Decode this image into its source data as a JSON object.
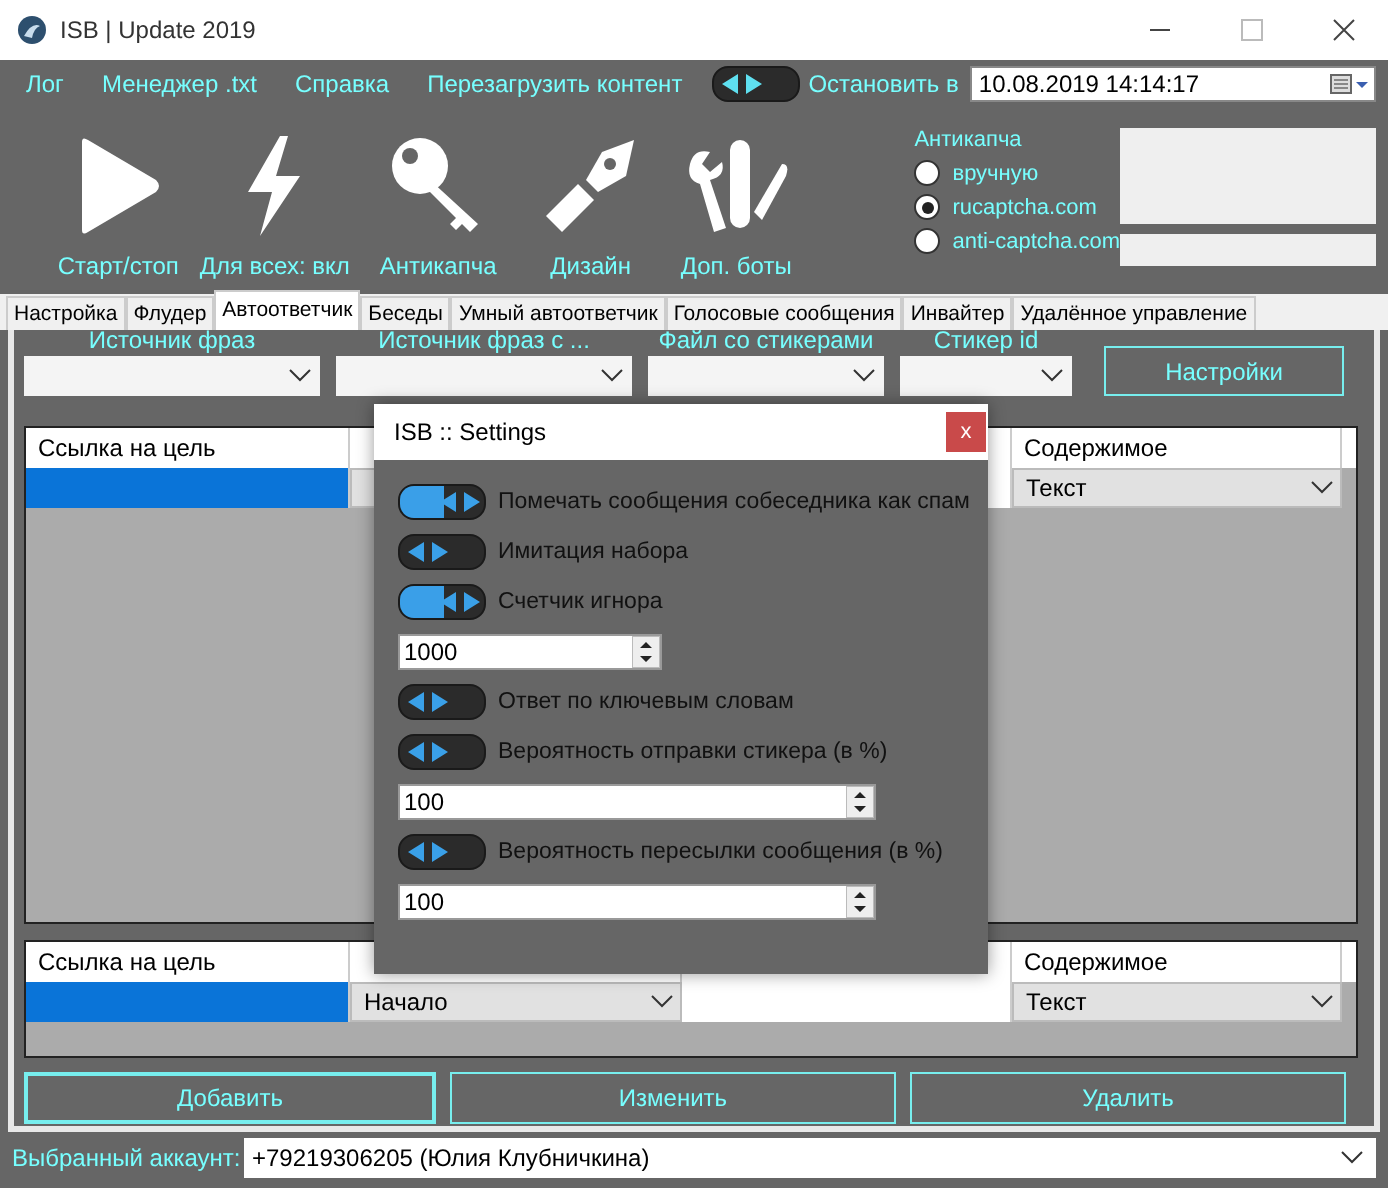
{
  "window": {
    "title": "ISB | Update 2019"
  },
  "menu": [
    "Лог",
    "Менеджер .txt",
    "Справка",
    "Перезагрузить контент"
  ],
  "stop_toggle": {
    "on": false
  },
  "stop_label": "Остановить в",
  "stop_date": "10.08.2019 14:14:17",
  "toolbar": [
    {
      "kind": "play",
      "label": "Старт/стоп"
    },
    {
      "kind": "bolt",
      "label": "Для всех: вкл"
    },
    {
      "kind": "key",
      "label": "Антикапча"
    },
    {
      "kind": "pen",
      "label": "Дизайн"
    },
    {
      "kind": "tools",
      "label": "Доп. боты"
    }
  ],
  "anticaptcha": {
    "title": "Антикапча",
    "options": [
      {
        "label": "вручную",
        "selected": false
      },
      {
        "label": "rucaptcha.com",
        "selected": true
      },
      {
        "label": "anti-captcha.com",
        "selected": false
      }
    ]
  },
  "tabs": [
    {
      "label": "Настройка",
      "selected": false
    },
    {
      "label": "Флудер",
      "selected": false
    },
    {
      "label": "Автоответчик",
      "selected": true
    },
    {
      "label": "Беседы",
      "selected": false
    },
    {
      "label": "Умный автоответчик",
      "selected": false
    },
    {
      "label": "Голосовые сообщения",
      "selected": false
    },
    {
      "label": "Инвайтер",
      "selected": false
    },
    {
      "label": "Удалённое управление",
      "selected": false
    }
  ],
  "filters": [
    "Источник фраз",
    "Источник фраз с ...",
    "Файл со стикерами",
    "Стикер id"
  ],
  "settings_button": "Настройки",
  "upper_table": {
    "columns": [
      "Ссылка на цель",
      "Содержимое"
    ],
    "row": {
      "selected": true,
      "content": "Текст"
    }
  },
  "lower_table": {
    "columns": [
      "Ссылка на цель",
      "Содержимое"
    ],
    "row": {
      "selected": true,
      "type": "Начало",
      "content": "Текст"
    }
  },
  "buttons": [
    "Добавить",
    "Изменить",
    "Удалить"
  ],
  "account": {
    "label": "Выбранный аккаунт:",
    "value": "+79219306205 (Юлия Клубничкина)"
  },
  "dialog": {
    "title": "ISB :: Settings",
    "close": "x",
    "items": [
      {
        "kind": "toggle",
        "label": "Помечать сообщения собеседника как спам",
        "on": true
      },
      {
        "kind": "toggle",
        "label": "Имитация набора",
        "on": false
      },
      {
        "kind": "toggle",
        "label": "Счетчик игнора",
        "on": true
      },
      {
        "kind": "spinner",
        "value": "1000"
      },
      {
        "kind": "toggle",
        "label": "Ответ по ключевым словам",
        "on": false
      },
      {
        "kind": "toggle",
        "label": "Вероятность отправки стикера (в %)",
        "on": false
      },
      {
        "kind": "wide_spinner",
        "value": "100"
      },
      {
        "kind": "toggle",
        "label": "Вероятность пересылки сообщения (в %)",
        "on": false
      },
      {
        "kind": "wide_spinner",
        "value": "100"
      }
    ]
  }
}
